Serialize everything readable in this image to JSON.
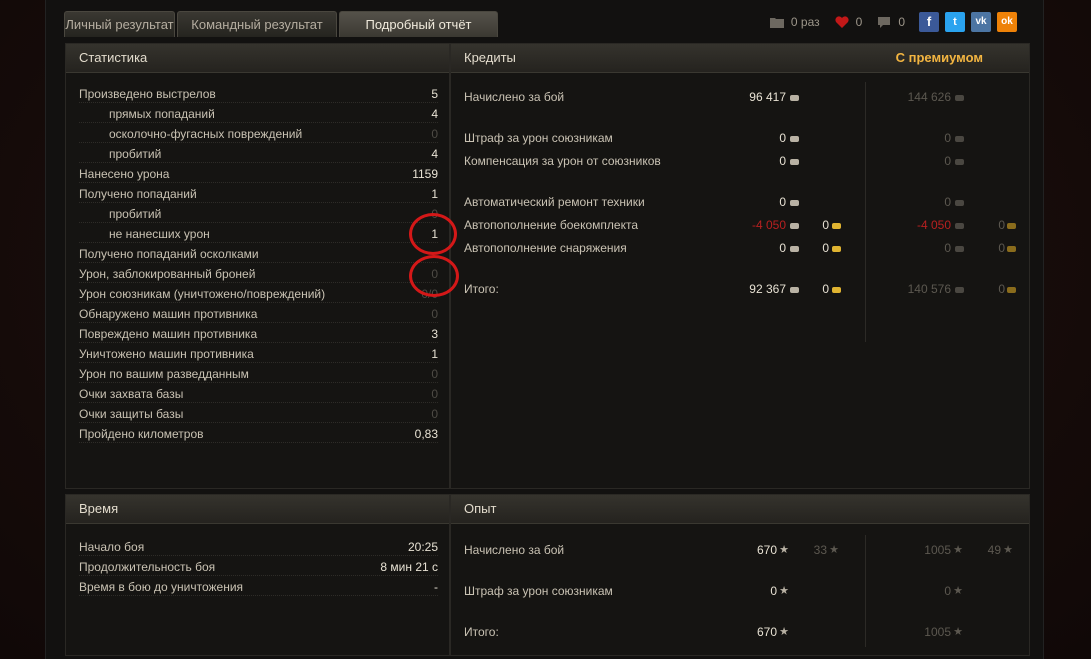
{
  "tabs": [
    {
      "label": "Личный результат"
    },
    {
      "label": "Командный результат"
    },
    {
      "label": "Подробный отчёт"
    }
  ],
  "social": {
    "views": "0 раз",
    "likes": "0",
    "comments": "0",
    "networks": [
      "f",
      "t",
      "vk",
      "ok"
    ]
  },
  "statistics": {
    "title": "Статистика",
    "rows": [
      {
        "label": "Произведено выстрелов",
        "value": "5"
      },
      {
        "label": "прямых попаданий",
        "value": "4"
      },
      {
        "label": "осколочно-фугасных повреждений",
        "value": "0"
      },
      {
        "label": "пробитий",
        "value": "4"
      },
      {
        "label": "Нанесено урона",
        "value": "1159"
      },
      {
        "label": "Получено попаданий",
        "value": "1"
      },
      {
        "label": "пробитий",
        "value": "0"
      },
      {
        "label": "не нанесших урон",
        "value": "1"
      },
      {
        "label": "Получено попаданий осколками",
        "value": ""
      },
      {
        "label": "Урон, заблокированный броней",
        "value": "0"
      },
      {
        "label": "Урон союзникам (уничтожено/повреждений)",
        "value": "0/0"
      },
      {
        "label": "Обнаружено машин противника",
        "value": "0"
      },
      {
        "label": "Повреждено машин противника",
        "value": "3"
      },
      {
        "label": "Уничтожено машин противника",
        "value": "1"
      },
      {
        "label": "Урон по вашим разведданным",
        "value": "0"
      },
      {
        "label": "Очки захвата базы",
        "value": "0"
      },
      {
        "label": "Очки защиты базы",
        "value": "0"
      },
      {
        "label": "Пройдено километров",
        "value": "0,83"
      }
    ]
  },
  "credits": {
    "title": "Кредиты",
    "premium_label": "С премиумом",
    "rows": [
      {
        "label": "Начислено за бой",
        "value": "96 417",
        "gold": "",
        "prem": "144 626",
        "prem_gold": ""
      },
      {
        "label": "Штраф за урон союзникам",
        "value": "0",
        "gold": "",
        "prem": "0",
        "prem_gold": ""
      },
      {
        "label": "Компенсация за урон от союзников",
        "value": "0",
        "gold": "",
        "prem": "0",
        "prem_gold": ""
      },
      {
        "label": "Автоматический ремонт техники",
        "value": "0",
        "gold": "",
        "prem": "0",
        "prem_gold": ""
      },
      {
        "label": "Автопополнение боекомплекта",
        "value": "-4 050",
        "gold": "0",
        "prem": "-4 050",
        "prem_gold": "0"
      },
      {
        "label": "Автопополнение снаряжения",
        "value": "0",
        "gold": "0",
        "prem": "0",
        "prem_gold": "0"
      },
      {
        "label": "Итого:",
        "value": "92 367",
        "gold": "0",
        "prem": "140 576",
        "prem_gold": "0"
      }
    ]
  },
  "time": {
    "title": "Время",
    "rows": [
      {
        "label": "Начало боя",
        "value": "20:25"
      },
      {
        "label": "Продолжительность боя",
        "value": "8 мин 21 с"
      },
      {
        "label": "Время в бою до уничтожения",
        "value": "-"
      }
    ]
  },
  "experience": {
    "title": "Опыт",
    "rows": [
      {
        "label": "Начислено за бой",
        "value": "670",
        "free": "33",
        "prem": "1005",
        "prem_free": "49"
      },
      {
        "label": "Штраф за урон союзникам",
        "value": "0",
        "free": "",
        "prem": "0",
        "prem_free": ""
      },
      {
        "label": "Итого:",
        "value": "670",
        "free": "",
        "prem": "1005",
        "prem_free": ""
      }
    ]
  },
  "colors": {
    "accent": "#f3b541",
    "negative": "#b82020",
    "highlight_circle": "#d41818"
  },
  "icons": {
    "star": "★"
  }
}
